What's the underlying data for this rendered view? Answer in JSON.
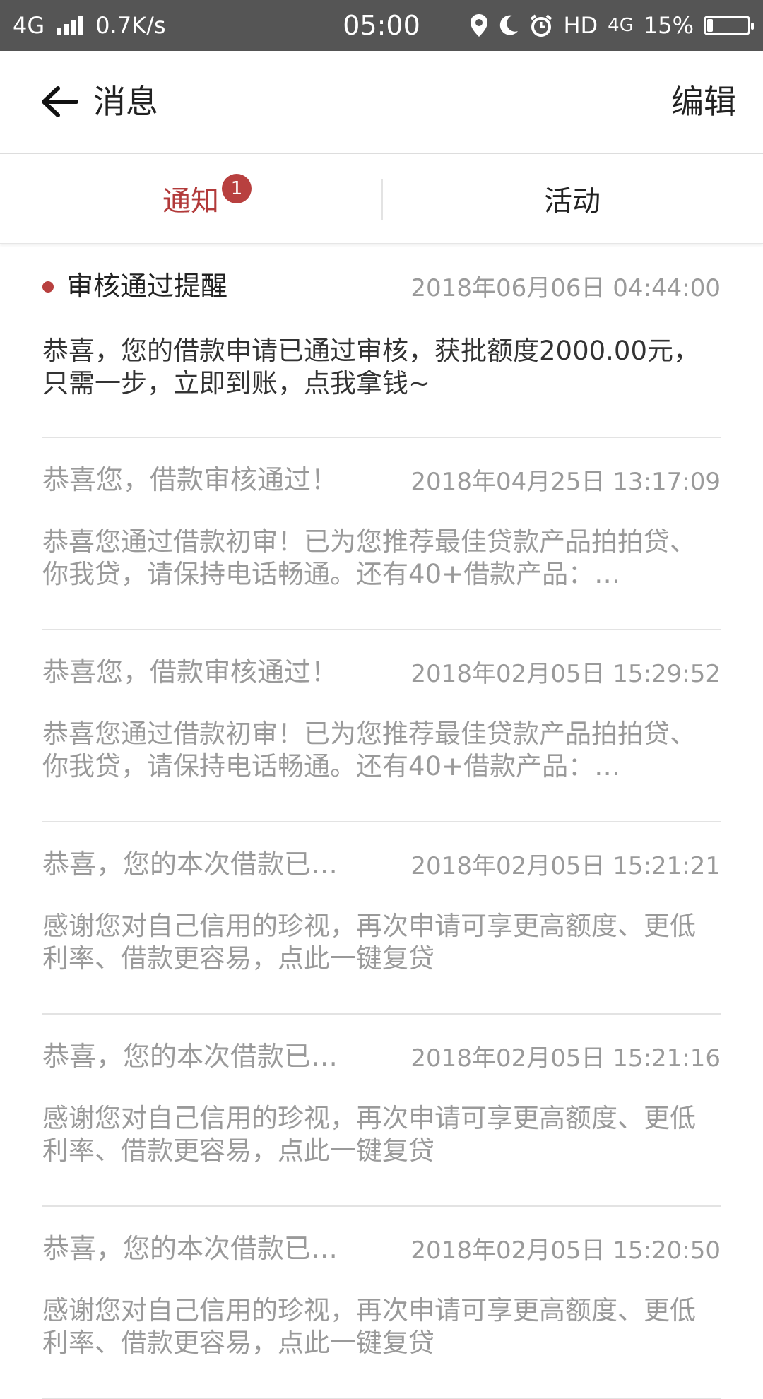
{
  "status_bar": {
    "network": "4G",
    "speed": "0.7K/s",
    "time": "05:00",
    "hd": "HD",
    "net2": "4G",
    "battery": "15%",
    "battery_level": 0.15
  },
  "header": {
    "title": "消息",
    "edit_label": "编辑"
  },
  "tabs": [
    {
      "label": "通知",
      "active": true,
      "badge": "1"
    },
    {
      "label": "活动",
      "active": false
    }
  ],
  "colors": {
    "accent": "#b23a3a",
    "badge": "#b8403f",
    "status_bar": "#555555"
  },
  "messages": [
    {
      "title": "审核通过提醒",
      "time": "2018年06月06日 04:44:00",
      "body": "恭喜，您的借款申请已通过审核，获批额度2000.00元，只需一步，立即到账，点我拿钱~",
      "unread": true
    },
    {
      "title": "恭喜您，借款审核通过！",
      "time": "2018年04月25日 13:17:09",
      "body": "恭喜您通过借款初审！已为您推荐最佳贷款产品拍拍贷、你我贷，请保持电话畅通。还有40+借款产品：…",
      "unread": false
    },
    {
      "title": "恭喜您，借款审核通过！",
      "time": "2018年02月05日 15:29:52",
      "body": "恭喜您通过借款初审！已为您推荐最佳贷款产品拍拍贷、你我贷，请保持电话畅通。还有40+借款产品：…",
      "unread": false
    },
    {
      "title": "恭喜，您的本次借款已…",
      "time": "2018年02月05日 15:21:21",
      "body": "感谢您对自己信用的珍视，再次申请可享更高额度、更低利率、借款更容易，点此一键复贷",
      "unread": false
    },
    {
      "title": "恭喜，您的本次借款已…",
      "time": "2018年02月05日 15:21:16",
      "body": "感谢您对自己信用的珍视，再次申请可享更高额度、更低利率、借款更容易，点此一键复贷",
      "unread": false
    },
    {
      "title": "恭喜，您的本次借款已…",
      "time": "2018年02月05日 15:20:50",
      "body": "感谢您对自己信用的珍视，再次申请可享更高额度、更低利率、借款更容易，点此一键复贷",
      "unread": false
    }
  ]
}
